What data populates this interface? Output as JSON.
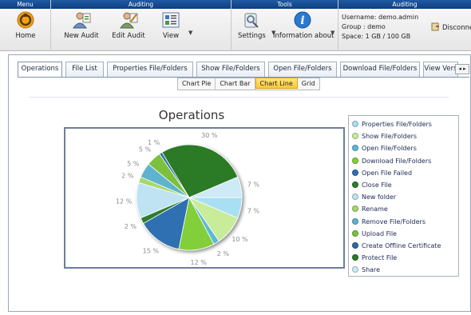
{
  "ribbon": {
    "groups": {
      "menu": {
        "title": "Menu"
      },
      "auditing": {
        "title": "Auditing"
      },
      "tools": {
        "title": "Tools"
      },
      "account": {
        "title": "Auditing"
      }
    },
    "buttons": {
      "home": "Home",
      "new_audit": "New Audit",
      "edit_audit": "Edit Audit",
      "view": "View",
      "settings": "Settings",
      "information": "Information about"
    },
    "account": {
      "username": "Username: demo.admin",
      "group": "Group : demo",
      "space": "Space: 1 GB / 100 GB",
      "disconnect": "Disconne"
    }
  },
  "tabs": [
    {
      "label": "Operations",
      "active": true
    },
    {
      "label": "File List"
    },
    {
      "label": "Properties File/Folders"
    },
    {
      "label": "Show File/Folders"
    },
    {
      "label": "Open File/Folders"
    },
    {
      "label": "Download File/Folders"
    },
    {
      "label": "View Vers"
    }
  ],
  "view_modes": [
    "Chart Pie",
    "Chart Bar",
    "Chart Line",
    "Grid"
  ],
  "active_view": "Chart Line",
  "chart_data": {
    "type": "pie",
    "title": "Operations",
    "slices": [
      {
        "label": "Properties File/Folders",
        "value": 7,
        "color": "#a9dff2"
      },
      {
        "label": "Show File/Folders",
        "value": 10,
        "color": "#c8ec9a"
      },
      {
        "label": "Open File/Folders",
        "value": 2,
        "color": "#5cb8d6"
      },
      {
        "label": "Download File/Folders",
        "value": 12,
        "color": "#82cf3a"
      },
      {
        "label": "Open File Failed",
        "value": 15,
        "color": "#2f6fb1"
      },
      {
        "label": "Close File",
        "value": 2,
        "color": "#2e7d2e"
      },
      {
        "label": "New folder",
        "value": 12,
        "color": "#bfe3f3"
      },
      {
        "label": "Rename",
        "value": 2,
        "color": "#a6d86e"
      },
      {
        "label": "Remove File/Folders",
        "value": 5,
        "color": "#5fb3cf"
      },
      {
        "label": "Upload File",
        "value": 5,
        "color": "#7cc13c"
      },
      {
        "label": "Create Offline Certificate",
        "value": 1,
        "color": "#2b6aa8"
      },
      {
        "label": "Protect File",
        "value": 30,
        "color": "#2a7a28"
      },
      {
        "label": "Share",
        "value": 7,
        "color": "#cdeaf6"
      }
    ],
    "legend_position": "right"
  },
  "colors": {
    "ribbon_header": "#0d3f7e",
    "active_view": "#ffc83a",
    "tab_border": "#7f93ad"
  }
}
